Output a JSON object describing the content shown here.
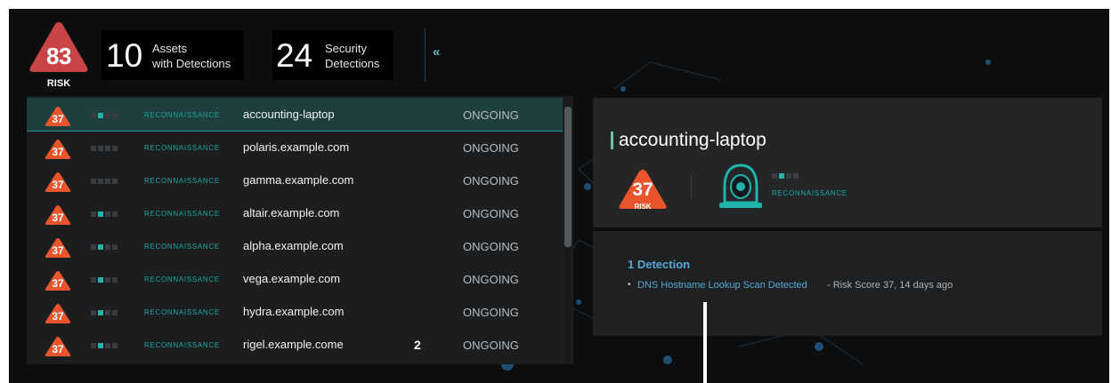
{
  "header": {
    "risk": {
      "score": "83",
      "label": "RISK"
    },
    "assets": {
      "count": "10",
      "label_line1": "Assets",
      "label_line2": "with Detections"
    },
    "detections": {
      "count": "24",
      "label_line1": "Security",
      "label_line2": "Detections"
    },
    "collapse_glyph": "«"
  },
  "hosts": [
    {
      "score": "37",
      "phase": "RECONNAISSANCE",
      "name": "accounting-laptop",
      "status": "ONGOING",
      "pips": [
        0,
        1,
        0,
        0
      ],
      "selected": true
    },
    {
      "score": "37",
      "phase": "RECONNAISSANCE",
      "name": "polaris.example.com",
      "status": "ONGOING",
      "pips": [
        0,
        0,
        0,
        0
      ]
    },
    {
      "score": "37",
      "phase": "RECONNAISSANCE",
      "name": "gamma.example.com",
      "status": "ONGOING",
      "pips": [
        0,
        0,
        0,
        0
      ]
    },
    {
      "score": "37",
      "phase": "RECONNAISSANCE",
      "name": "altair.example.com",
      "status": "ONGOING",
      "pips": [
        0,
        1,
        0,
        0
      ]
    },
    {
      "score": "37",
      "phase": "RECONNAISSANCE",
      "name": "alpha.example.com",
      "status": "ONGOING",
      "pips": [
        0,
        1,
        0,
        0
      ]
    },
    {
      "score": "37",
      "phase": "RECONNAISSANCE",
      "name": "vega.example.com",
      "status": "ONGOING",
      "pips": [
        0,
        1,
        0,
        0
      ]
    },
    {
      "score": "37",
      "phase": "RECONNAISSANCE",
      "name": "hydra.example.com",
      "status": "ONGOING",
      "pips": [
        0,
        1,
        0,
        0
      ]
    },
    {
      "score": "37",
      "phase": "RECONNAISSANCE",
      "name": "rigel.example.come",
      "status": "ONGOING",
      "pips": [
        0,
        1,
        0,
        0
      ],
      "marker": "2"
    }
  ],
  "detail": {
    "title": "accounting-laptop",
    "score": "37",
    "risk_label": "RISK",
    "phase": "RECONNAISSANCE",
    "pips": [
      0,
      1,
      0,
      0
    ],
    "detections_count": "1 Detection",
    "detection_items": [
      {
        "name": "DNS Hostname Lookup Scan Detected",
        "meta": "- Risk Score 37, 14 days ago"
      }
    ]
  },
  "colors": {
    "risk_orange": "#e8552d",
    "risk_red": "#c94444",
    "teal": "#1fb5ad",
    "link_blue": "#57a9d6",
    "selected_row": "#1f3e3e"
  }
}
